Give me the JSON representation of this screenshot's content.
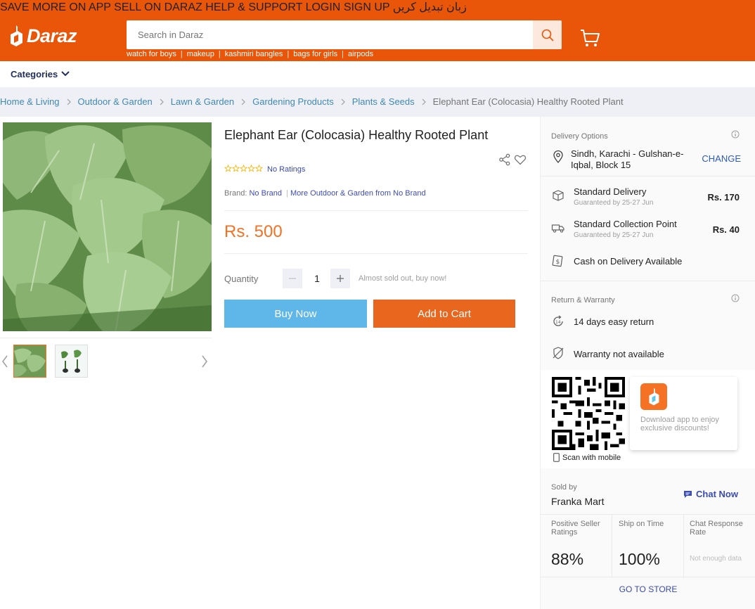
{
  "header": {
    "topbar": [
      "SAVE MORE ON APP",
      "SELL ON DARAZ",
      "HELP & SUPPORT",
      "LOGIN",
      "SIGN UP",
      "زبان تبدیل کریں"
    ],
    "logo_text": "Daraz",
    "search_placeholder": "Search in Daraz",
    "suggestions": [
      "watch for boys",
      "makeup",
      "kashmiri bangles",
      "bags for girls",
      "airpods"
    ]
  },
  "categories_label": "Categories",
  "breadcrumb": [
    "Home & Living",
    "Outdoor & Garden",
    "Lawn & Garden",
    "Gardening Products",
    "Plants & Seeds",
    "Elephant Ear (Colocasia) Healthy Rooted Plant"
  ],
  "product": {
    "title": "Elephant Ear (Colocasia) Healthy Rooted Plant",
    "ratings_text": "No Ratings",
    "brand_label": "Brand:",
    "brand_name": "No Brand",
    "brand_more": "More Outdoor & Garden from No Brand",
    "price": "Rs. 500",
    "quantity_label": "Quantity",
    "quantity_value": "1",
    "stock_note": "Almost sold out, buy now!",
    "buy_now": "Buy Now",
    "add_to_cart": "Add to Cart"
  },
  "delivery": {
    "heading": "Delivery Options",
    "address": "Sindh, Karachi - Gulshan-e-Iqbal, Block 15",
    "change": "CHANGE",
    "options": [
      {
        "name": "Standard Delivery",
        "sub": "Guaranteed by 25-27 Jun",
        "fee": "Rs. 170"
      },
      {
        "name": "Standard Collection Point",
        "sub": "Guaranteed by 25-27 Jun",
        "fee": "Rs. 40"
      }
    ],
    "cod": "Cash on Delivery Available"
  },
  "warranty": {
    "heading": "Return & Warranty",
    "return": "14 days easy return",
    "warranty": "Warranty not available"
  },
  "app": {
    "scan": "Scan with mobile",
    "promo": "Download app to enjoy exclusive discounts!"
  },
  "seller": {
    "sold_by": "Sold by",
    "name": "Franka Mart",
    "chat": "Chat Now",
    "metrics": [
      {
        "label": "Positive Seller Ratings",
        "value": "88%"
      },
      {
        "label": "Ship on Time",
        "value": "100%"
      },
      {
        "label": "Chat Response Rate",
        "value": "Not enough data"
      }
    ],
    "go_to_store": "GO TO STORE"
  },
  "colors": {
    "brand": "#e9560a",
    "price": "#f57224",
    "buy_now": "#5fb6e9",
    "add_to_cart": "#e9661f",
    "link": "#3a4bb3"
  }
}
